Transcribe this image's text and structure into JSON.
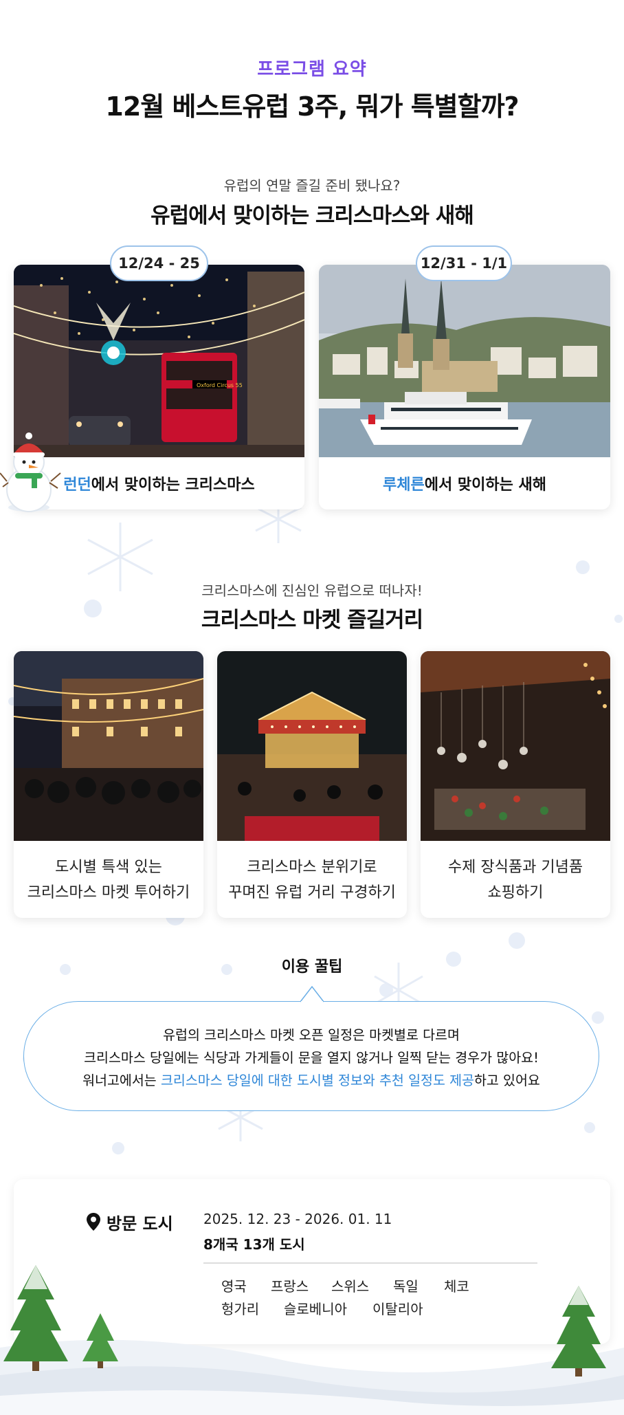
{
  "header": {
    "eyebrow": "프로그램 요약",
    "title": "12월 베스트유럽 3주, 뭐가 특별할까?"
  },
  "section_holidays": {
    "subtitle": "유럽의 연말 즐길 준비 됐나요?",
    "title": "유럽에서 맞이하는 크리스마스와 새해",
    "cards": [
      {
        "date": "12/24 - 25",
        "city": "런던",
        "caption_rest": "에서 맞이하는 크리스마스",
        "image": "London Christmas street with red double-decker bus"
      },
      {
        "date": "12/31 - 1/1",
        "city": "루체른",
        "caption_rest": "에서 맞이하는 새해",
        "image": "Lucerne lakeside with cruise ship and church spires"
      }
    ]
  },
  "section_markets": {
    "subtitle": "크리스마스에 진심인 유럽으로 떠나자!",
    "title": "크리스마스 마켓 즐길거리",
    "cards": [
      {
        "line1": "도시별 특색 있는",
        "line2": "크리스마스 마켓 투어하기",
        "image": "Christmas market crowd with lights"
      },
      {
        "line1": "크리스마스 분위기로",
        "line2": "꾸며진 유럽 거리 구경하기",
        "image": "Carousel at Christmas market"
      },
      {
        "line1": "수제 장식품과 기념품",
        "line2": "쇼핑하기",
        "image": "Stall with handmade ornaments"
      }
    ]
  },
  "tip": {
    "label": "이용 꿀팁",
    "line1": "유럽의 크리스마스 마켓 오픈 일정은 마켓별로 다르며",
    "line2": "크리스마스 당일에는 식당과 가게들이 문을 열지 않거나 일찍 닫는 경우가 많아요!",
    "line3_prefix": "워너고에서는 ",
    "line3_highlight": "크리스마스 당일에 대한 도시별 정보와 추천 일정도 제공",
    "line3_suffix": "하고 있어요"
  },
  "visit": {
    "icon": "location-pin-icon",
    "label": "방문 도시",
    "dates": "2025. 12. 23 - 2026. 01. 11",
    "count": "8개국 13개 도시",
    "countries": [
      "영국",
      "프랑스",
      "스위스",
      "독일",
      "체코",
      "헝가리",
      "슬로베니아",
      "이탈리아"
    ]
  },
  "colors": {
    "accent_purple": "#7a4de6",
    "highlight_blue": "#2f87d8",
    "bubble_border": "#6aaee6"
  }
}
